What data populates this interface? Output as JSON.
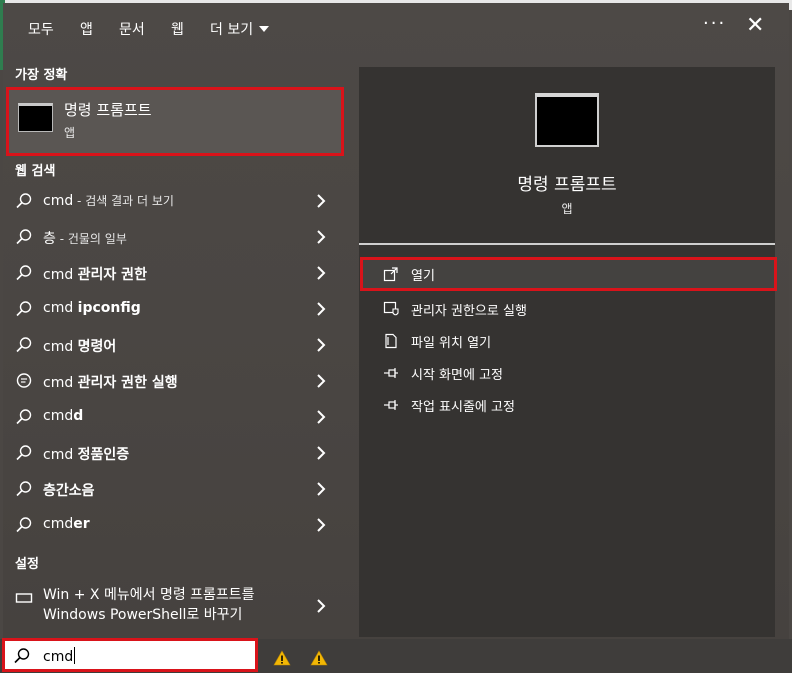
{
  "tabs": {
    "all": "모두",
    "apps": "앱",
    "documents": "문서",
    "web": "웹",
    "more": "더 보기"
  },
  "window": {
    "more_label": "···",
    "close_label": "✕"
  },
  "left": {
    "best_match_header": "가장 정확",
    "best_match": {
      "title": "명령 프롬프트",
      "subtitle": "앱"
    },
    "web_header": "웹 검색",
    "results": [
      {
        "prefix": "cmd",
        "bold": "",
        "hint": " - 검색 결과 더 보기",
        "icon": "search-icon"
      },
      {
        "prefix": "층",
        "bold": "",
        "hint": " - 건물의 일부",
        "icon": "search-icon"
      },
      {
        "prefix": "cmd ",
        "bold": "관리자 권한",
        "hint": "",
        "icon": "search-icon"
      },
      {
        "prefix": "cmd ",
        "bold": "ipconfig",
        "hint": "",
        "icon": "search-icon"
      },
      {
        "prefix": "cmd ",
        "bold": "명령어",
        "hint": "",
        "icon": "search-icon"
      },
      {
        "prefix": "cmd ",
        "bold": "관리자 권한 실행",
        "hint": "",
        "icon": "chat-icon"
      },
      {
        "prefix": "cmd",
        "bold": "d",
        "hint": "",
        "icon": "search-icon"
      },
      {
        "prefix": "cmd ",
        "bold": "정품인증",
        "hint": "",
        "icon": "search-icon"
      },
      {
        "prefix": "",
        "bold": "층간소음",
        "hint": "",
        "icon": "search-icon"
      },
      {
        "prefix": "cmd",
        "bold": "er",
        "hint": "",
        "icon": "search-icon"
      }
    ],
    "settings_header": "설정",
    "settings_item": {
      "line1": "Win + X 메뉴에서 명령 프롬프트를",
      "line2": "Windows PowerShell로 바꾸기",
      "icon": "display-icon"
    }
  },
  "right": {
    "app_title": "명령 프롬프트",
    "app_subtitle": "앱",
    "actions": [
      {
        "label": "열기",
        "icon": "open-icon"
      },
      {
        "label": "관리자 권한으로 실행",
        "icon": "shield-icon"
      },
      {
        "label": "파일 위치 열기",
        "icon": "file-location-icon"
      },
      {
        "label": "시작 화면에 고정",
        "icon": "pin-icon"
      },
      {
        "label": "작업 표시줄에 고정",
        "icon": "pin-icon"
      }
    ]
  },
  "taskbar": {
    "search_value": "cmd"
  },
  "colors": {
    "highlight": "#d9131a",
    "panel": "#353331",
    "background": "#4b4744"
  }
}
